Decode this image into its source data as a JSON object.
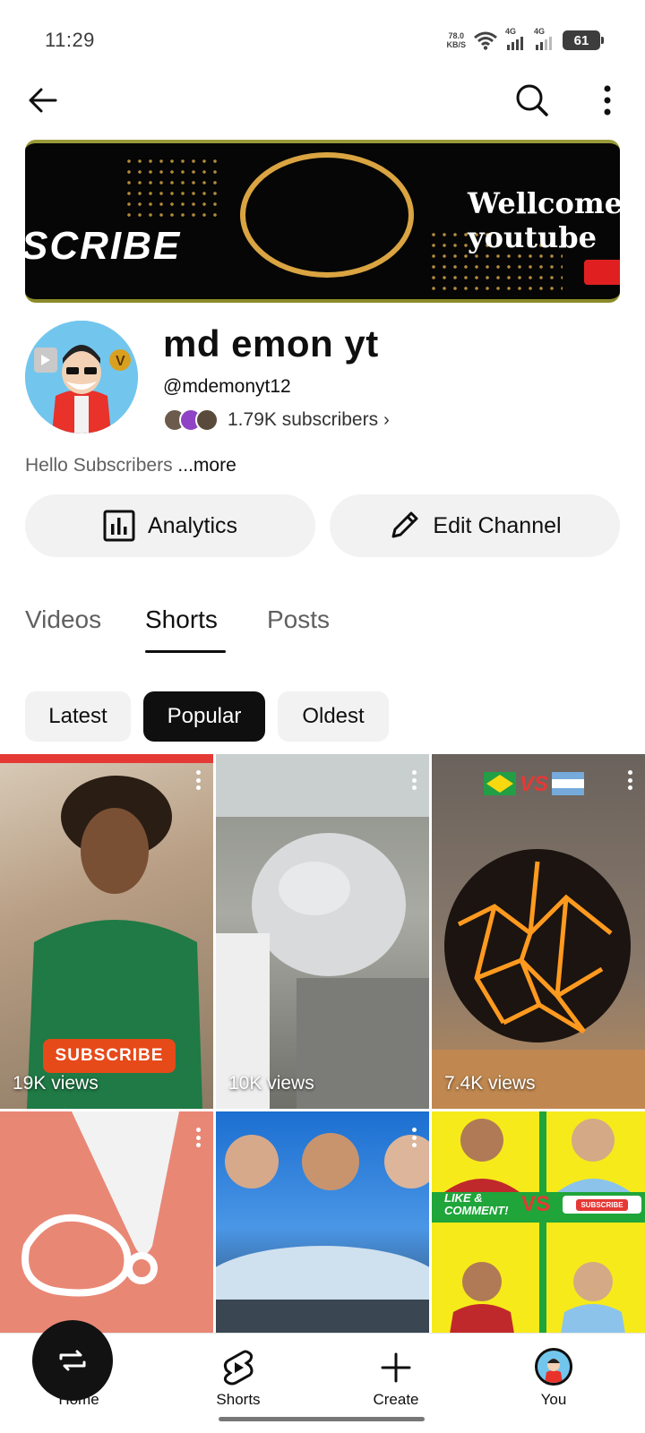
{
  "status_bar": {
    "time": "11:29",
    "net_speed_value": "78.0",
    "net_speed_unit": "KB/S",
    "signal_1_label": "4G",
    "signal_2_label": "4G",
    "battery_level": "61",
    "icons": [
      "wifi-icon",
      "signal-icon",
      "signal-icon",
      "battery-icon"
    ]
  },
  "top_bar": {
    "icons": [
      "back-arrow-icon",
      "search-icon",
      "more-vertical-icon"
    ]
  },
  "banner": {
    "left_text": "SCRIBE",
    "right_text_line1": "Wellcome",
    "right_text_line2": "youtube"
  },
  "channel": {
    "name": "md emon yt",
    "handle": "@mdemonyt12",
    "subscribers": "1.79K subscribers",
    "description": "Hello Subscribers",
    "more_label": "...more"
  },
  "actions": {
    "analytics_label": "Analytics",
    "edit_label": "Edit Channel"
  },
  "tabs": [
    {
      "label": "Videos",
      "active": false
    },
    {
      "label": "Shorts",
      "active": true
    },
    {
      "label": "Posts",
      "active": false
    }
  ],
  "sort_chips": [
    {
      "label": "Latest",
      "active": false
    },
    {
      "label": "Popular",
      "active": true
    },
    {
      "label": "Oldest",
      "active": false
    }
  ],
  "shorts": [
    {
      "views": "19K views",
      "overlay_text": "SUBSCRIBE"
    },
    {
      "views": "10K views"
    },
    {
      "views": "7.4K views",
      "overlay_text": "VS"
    },
    {
      "views": ""
    },
    {
      "views": ""
    },
    {
      "views": "",
      "overlay_text": "LIKE & COMMENT!",
      "overlay_text_2": "VS",
      "overlay_text_3": "SUBSCRIBE"
    }
  ],
  "bottom_nav": [
    {
      "label": "Home",
      "icon": "home-icon"
    },
    {
      "label": "Shorts",
      "icon": "shorts-icon"
    },
    {
      "label": "Create",
      "icon": "plus-icon"
    },
    {
      "label": "You",
      "icon": "avatar"
    }
  ],
  "colors": {
    "accent": "#0f0f0f",
    "chip_bg": "#f2f2f2",
    "secondary_text": "#606060"
  }
}
